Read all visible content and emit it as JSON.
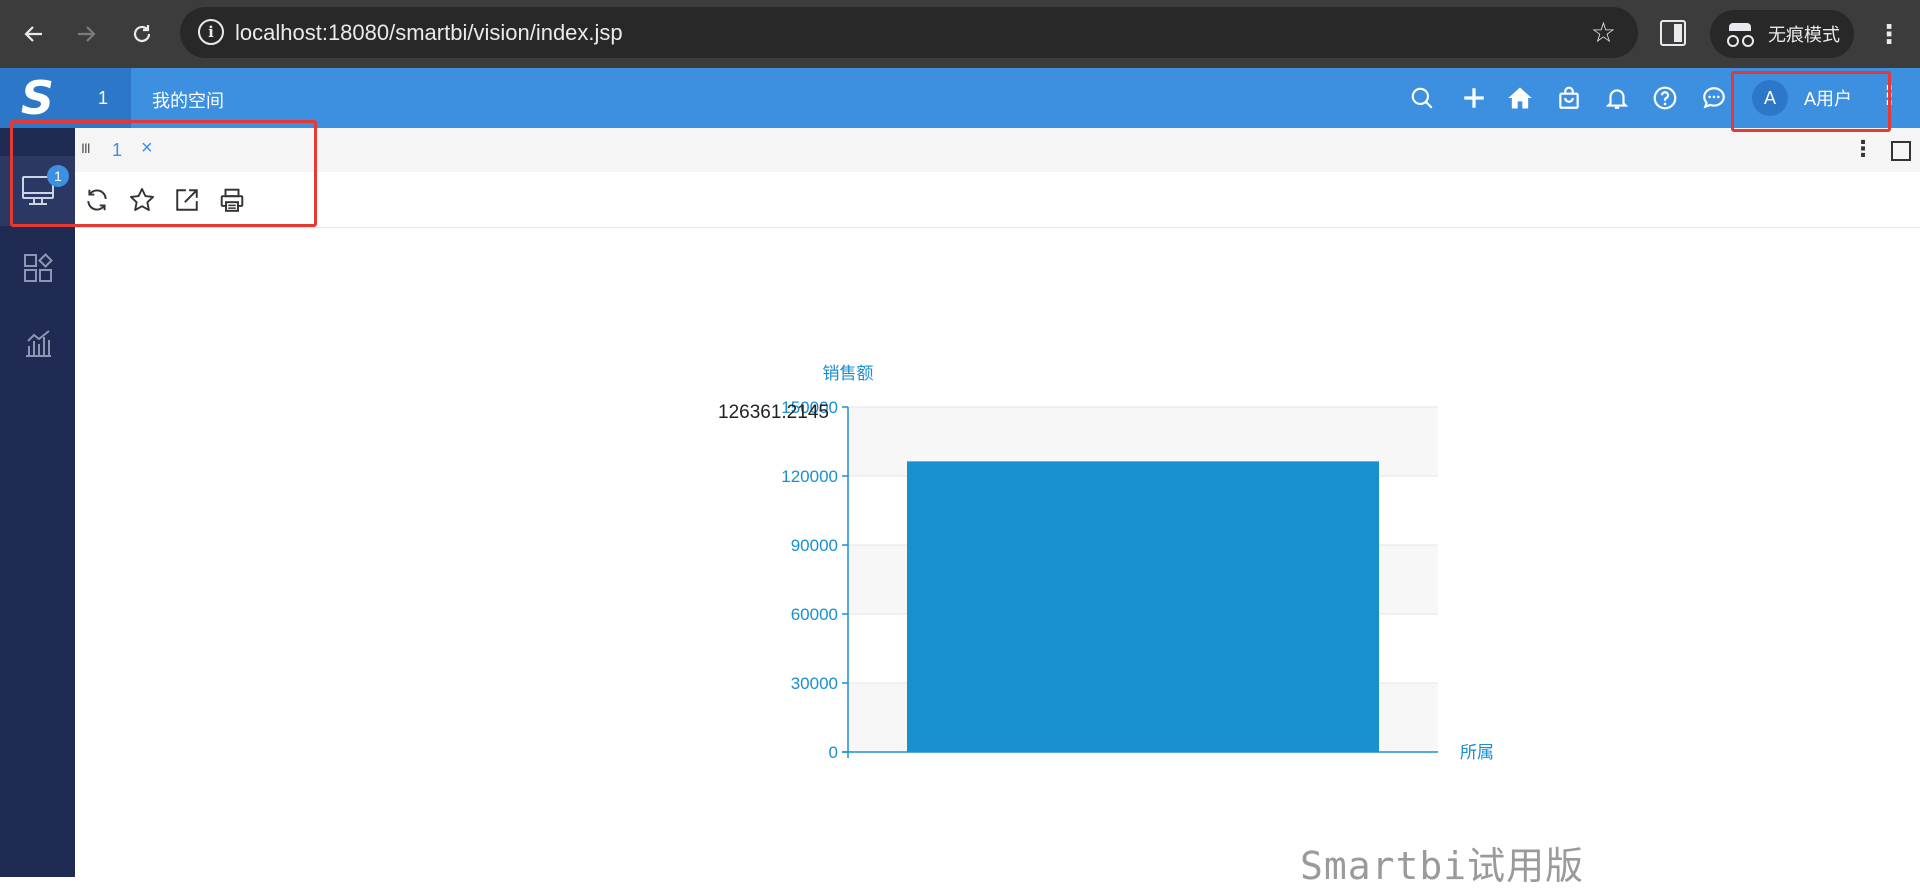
{
  "browser": {
    "url": "localhost:18080/smartbi/vision/index.jsp",
    "incognito_label": "无痕模式",
    "icons": [
      "back-arrow-icon",
      "forward-arrow-icon",
      "reload-icon",
      "site-info-icon",
      "bookmark-star-icon",
      "side-panel-icon",
      "incognito-icon",
      "browser-menu-icon"
    ]
  },
  "header": {
    "logo": "S",
    "space_tab": "1",
    "space_title": "我的空间",
    "user_initial": "A",
    "user_name": "A用户",
    "icons": [
      "search-icon",
      "plus-icon",
      "home-icon",
      "bag-icon",
      "bell-icon",
      "help-icon",
      "chat-icon",
      "more-vertical-icon"
    ]
  },
  "sidebar": {
    "badge": "1",
    "items": [
      "monitor-icon",
      "apps-icon",
      "chart-bar-icon"
    ]
  },
  "tabs": {
    "drag_handle": "III",
    "active_tab": "1",
    "close": "×"
  },
  "toolbar": {
    "icons": [
      "refresh-icon",
      "favorite-star-icon",
      "open-external-icon",
      "print-icon"
    ]
  },
  "chart_data": {
    "type": "bar",
    "categories": [
      ""
    ],
    "values": [
      126361.2145
    ],
    "data_label": "126361.2145",
    "ylabel": "销售额",
    "xlabel": "所属",
    "ylim": [
      0,
      150000
    ],
    "yticks": [
      "0",
      "30000",
      "60000",
      "90000",
      "120000",
      "150000"
    ],
    "grid": true,
    "colors": {
      "bar": "#1890d0",
      "axis": "#1890d0",
      "label": "#1890d0"
    }
  },
  "watermark": "Smartbi试用版",
  "colors": {
    "header_blue": "#3d8fe0",
    "sidebar_navy": "#1f2b52",
    "highlight_red": "#e53935"
  }
}
